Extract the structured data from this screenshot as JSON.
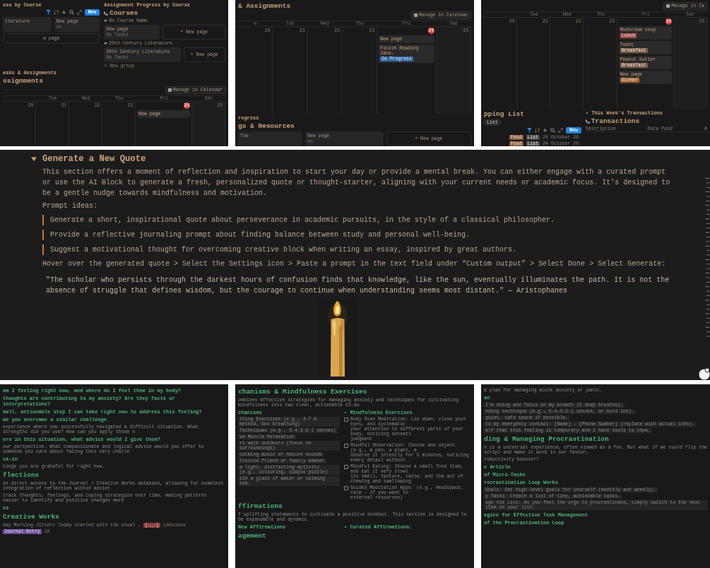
{
  "top_panels": [
    {
      "blocks": [
        {
          "kind": "columns",
          "columns": [
            [
              {
                "kind": "heading",
                "text": "ess by Course"
              },
              {
                "kind": "toolbar",
                "new_button": "New"
              },
              {
                "kind": "cards",
                "cards": [
                  {
                    "title": "iterature"
                  },
                  {
                    "title": "New page",
                    "sub": "on"
                  }
                ]
              },
              {
                "kind": "cards",
                "cards": [
                  {
                    "title": "w page",
                    "ghost": true
                  }
                ]
              }
            ],
            [
              {
                "kind": "heading",
                "text": "Assignment Progress by Course"
              },
              {
                "kind": "db_title",
                "text": "Courses"
              },
              {
                "kind": "group",
                "text": "No Course Name"
              },
              {
                "kind": "cards",
                "cards": [
                  {
                    "title": "New page",
                    "sub": "No Tasks"
                  },
                  {
                    "title": "+ New page",
                    "ghost": true
                  }
                ]
              },
              {
                "kind": "group",
                "text": "20th Century Literature"
              },
              {
                "kind": "cards",
                "cards": [
                  {
                    "title": "20th Century Literature",
                    "sub": "No Tasks"
                  },
                  {
                    "title": "+ New page",
                    "ghost": true
                  }
                ]
              },
              {
                "kind": "add_link",
                "text": "+ New group"
              }
            ]
          ]
        },
        {
          "kind": "subheading",
          "text": "asks & Assignments"
        },
        {
          "kind": "title",
          "text": "ssignments"
        },
        {
          "kind": "toolbar",
          "manage_button": "Manage in Calendar"
        },
        {
          "kind": "calendar",
          "columns": [
            {
              "date": "20"
            },
            {
              "day": "Tue",
              "date": "21"
            },
            {
              "day": "Wed",
              "date": "22"
            },
            {
              "day": "Thu",
              "date": "23"
            },
            {
              "day": "Fri",
              "date": "24",
              "today": true,
              "events": [
                {
                  "title": "New page"
                }
              ]
            },
            {
              "day": "Sat",
              "date": "25"
            }
          ]
        }
      ]
    },
    {
      "blocks": [
        {
          "kind": "title",
          "text": "& Assignments"
        },
        {
          "kind": "toolbar",
          "manage_button": "Manage in Calendar"
        },
        {
          "kind": "calendar",
          "columns": [
            {
              "day": "e",
              "date": "20"
            },
            {
              "day": "Tue",
              "date": "21"
            },
            {
              "day": "Wed",
              "date": "22"
            },
            {
              "day": "Thu",
              "date": "23"
            },
            {
              "day": "Fri",
              "date": "24",
              "today": true,
              "events": [
                {
                  "title": "New page"
                },
                {
                  "title": "Finish Reading Jane…",
                  "tag": "In Progress",
                  "color": "#2c6aa8"
                }
              ]
            },
            {
              "day": "Sat",
              "date": "25"
            }
          ]
        },
        {
          "kind": "subheading",
          "text": "rogress"
        },
        {
          "kind": "title",
          "text": "gs & Resources"
        },
        {
          "kind": "cards",
          "cards": [
            {
              "title": "Too"
            },
            {
              "title": "New page",
              "sub": "on"
            },
            {
              "title": "+ New page",
              "ghost": true
            }
          ]
        }
      ]
    },
    {
      "blocks": [
        {
          "kind": "toolbar",
          "manage_button": "Manage in Ca"
        },
        {
          "kind": "calendar",
          "columns": [
            {
              "date": "20"
            },
            {
              "day": "Tue",
              "date": "21"
            },
            {
              "day": "Wed",
              "date": "22"
            },
            {
              "day": "Thu",
              "date": "23"
            },
            {
              "day": "Fri",
              "date": "24",
              "today": true,
              "events": [
                {
                  "title": "Mushroom soup",
                  "tag": "Lunch",
                  "color": "#9c4a45"
                },
                {
                  "title": "Toast",
                  "tag": "Breakfast",
                  "color": "#7a5b47"
                },
                {
                  "title": "Peanut butter",
                  "tag": "Breakfast",
                  "color": "#7a5b47"
                },
                {
                  "title": "New page",
                  "tag": "Dinner",
                  "color": "#a5612c"
                }
              ]
            },
            {
              "day": "Sat",
              "date": "25"
            }
          ]
        },
        {
          "kind": "columns",
          "columns": [
            [
              {
                "kind": "title",
                "text": "pping List"
              },
              {
                "kind": "pill_tab",
                "text": "List"
              },
              {
                "kind": "toolbar",
                "new_button": "New"
              },
              {
                "kind": "db_row",
                "items": [
                  {
                    "kind": "tag",
                    "text": "Food",
                    "color": "#8a5f40"
                  },
                  {
                    "kind": "tag",
                    "text": "List",
                    "color": "#4a4a4a"
                  },
                  {
                    "kind": "text",
                    "text": "24 October 20…"
                  }
                ]
              },
              {
                "kind": "db_row",
                "items": [
                  {
                    "kind": "tag",
                    "text": "Food",
                    "color": "#8a5f40"
                  },
                  {
                    "kind": "tag",
                    "text": "List",
                    "color": "#4a4a4a"
                  },
                  {
                    "kind": "text",
                    "text": "24 October 20…"
                  }
                ]
              }
            ],
            [
              {
                "kind": "subheading",
                "text": "• This Week's Transactions"
              },
              {
                "kind": "db_title",
                "text": "Transactions"
              },
              {
                "kind": "table_header",
                "cells": [
                  "Description",
                  "Date Paid",
                  "A"
                ]
              }
            ]
          ]
        }
      ]
    }
  ],
  "quote_section": {
    "title": "Generate a New Quote",
    "expanded": true,
    "intro": "This section offers a moment of reflection and inspiration to start your day or provide a mental break. You can either engage with a curated prompt or use the AI Block to generate a fresh, personalized quote or thought-starter, aligning with your current needs or academic focus. It's designed to be a gentle nudge towards mindfulness and motivation.",
    "prompts_label": "Prompt ideas:",
    "prompts": [
      "Generate a short, inspirational quote about perseverance in academic pursuits, in the style of a classical philosopher.",
      "Provide a reflective journaling prompt about finding balance between study and personal well-being.",
      "Suggest a motivational thought for overcoming creative block when writing an essay, inspired by great authors."
    ],
    "instructions": "Hover over the generated quote > Select the Settings icon > Paste a prompt in the text field under “Custom output” > Select Done > Select Generate:",
    "quote": "\"The scholar who persists through the darkest hours of confusion finds that knowledge, like the sun, eventually illuminates the path. It is not the absence of struggle that defines wisdom, but the courage to continue when understanding seems most distant.\" — Aristophanes",
    "image": {
      "kind": "picture"
    }
  },
  "bottom_panels": [
    {
      "blocks": [
        {
          "kind": "subheading",
          "text": "am I feeling right now, and where do I feel them in my body?"
        },
        {
          "kind": "subheading",
          "text": "thoughts are contributing to my anxiety? Are they facts or interpretations?"
        },
        {
          "kind": "subheading",
          "text": "mall, actionable step I can take right now to address this feeling?"
        },
        {
          "kind": "subheading",
          "text": "me you overcame a similar challenge."
        },
        {
          "kind": "text",
          "text": "experience where you successfully navigated a difficult situation. What strengths did you use? How can you apply those n"
        },
        {
          "kind": "subheading",
          "text": "ere in this situation, what advice would I give them?"
        },
        {
          "kind": "text",
          "text": "our perspective. What compassionate and logical advice would you offer to someone you care about facing this very challe"
        },
        {
          "kind": "subheading",
          "text": "ck-in"
        },
        {
          "kind": "text",
          "text": "hings you are grateful for right now."
        },
        {
          "kind": "title",
          "text": "flections"
        },
        {
          "kind": "text",
          "text": "es direct access to the Journal / Creative Works database, allowing for seamless integration of reflection within anxiet"
        },
        {
          "kind": "text",
          "text": "track thoughts, feelings, and coping strategies over time, making patterns easier to identify and positive changes more"
        },
        {
          "kind": "subheading",
          "text": "es"
        },
        {
          "kind": "title",
          "text": "Creative Works"
        },
        {
          "kind": "db_row",
          "items": [
            {
              "kind": "text",
              "text": "day Morning Jitters"
            },
            {
              "kind": "text",
              "text": "Today started with the usual …"
            },
            {
              "kind": "tag",
              "text": "(-_-)",
              "color": "#8e3b3b"
            },
            {
              "kind": "page",
              "text": "Anxious"
            },
            {
              "kind": "tag",
              "text": "Journal Entry",
              "color": "#6b4a9c"
            },
            {
              "kind": "text",
              "text": "19"
            }
          ]
        }
      ]
    },
    {
      "blocks": [
        {
          "kind": "title",
          "text": "chanisms & Mindfulness Exercises"
        },
        {
          "kind": "text",
          "text": "ombines effective strategies for managing anxiety and techniques for cultivating mindfulness into two clear, actionable to-do"
        },
        {
          "kind": "columns",
          "columns": [
            [
              {
                "kind": "subheading",
                "text": "chanisms"
              },
              {
                "kind": "pills",
                "items": [
                  "thing Exercises (e.g., 4-7-8 method, box breathing)",
                  "Techniques (e.g., 5-4-3-2-1 senses)",
                  "ve Muscle Relaxation",
                  "rt walk outdoors (focus on surroundings)",
                  "calming music or nature sounds",
                  "trusted friend or family member",
                  "a light, distracting activity (e.g., colouring, simple puzzle)",
                  "ith a glass of water or calming tea."
                ]
              }
            ],
            [
              {
                "kind": "subheading",
                "text": "• Mindfulness Exercises"
              },
              {
                "kind": "checks",
                "items": [
                  {
                    "lines": [
                      "Body Scan Meditation: Lie down, close your eyes, and systematic",
                      "your attention to different parts of your body, noticing sensati",
                      "judgment"
                    ],
                    "checked": false
                  },
                  {
                    "lines": [
                      "Mindful Observation: Choose one object (e.g., a pen, a plant, a",
                      "observe it intently for 5 minutes, noticing every detail without"
                    ],
                    "checked": false
                  },
                  {
                    "lines": [
                      "Mindful Eating: Choose a small food item, and eat it very slowl",
                      "its smell, texture, taste, and the act of chewing and swallowing"
                    ],
                    "checked": false
                  },
                  {
                    "lines": [
                      "Guided Meditation Apps: (e.g., Headspace, Calm - if you want to",
                      "external resources)"
                    ],
                    "checked": false
                  }
                ]
              }
            ]
          ]
        },
        {
          "kind": "title",
          "text": "ffirmations"
        },
        {
          "kind": "text",
          "text": "f uplifting statements to cultivate a positive mindset. This section is designed to be expandable and dynamic."
        },
        {
          "kind": "columns",
          "columns": [
            [
              {
                "kind": "subheading",
                "text": "New Affirmations"
              }
            ],
            [
              {
                "kind": "subheading",
                "text": "• Curated Affirmations:"
              }
            ]
          ]
        },
        {
          "kind": "title",
          "text": "agement"
        }
      ]
    },
    {
      "blocks": [
        {
          "kind": "text",
          "text": "e plan for managing acute anxiety or panic."
        },
        {
          "kind": "subheading",
          "text": "an"
        },
        {
          "kind": "pills",
          "items": [
            "I'm doing and focus on my breath (5 deep breaths).",
            "nding technique (e.g., 5-4-3-2-1 senses, or hold ice).",
            "quiet, safe space if possible.",
            "to my emergency contact: [Name] - [Phone Number] (replace with actual info).",
            "elf that this feeling is temporary and I have tools to cope."
          ]
        },
        {
          "kind": "title",
          "text": "ding & Managing Procrastination"
        },
        {
          "kind": "text",
          "text": "n is a universal experience, often viewed as a foe. But what if we could flip the script and make it work in our favour,"
        },
        {
          "kind": "text",
          "text": "roductivity booster?"
        },
        {
          "kind": "subheading",
          "text": "e Article"
        },
        {
          "kind": "subheading",
          "text": "of Micro-Tasks"
        },
        {
          "kind": "subheading",
          "text": "rocrastination Loop Works"
        },
        {
          "kind": "pills",
          "items": [
            "Goals: Set high-level goals for yourself (monthly and weekly).",
            "y Tasks: Create a list of tiny, achievable tasks.",
            "ugh the List: As you feel the urge to procrastinate, simply switch to the next item on your list."
          ]
        },
        {
          "kind": "subheading",
          "text": "egies for Effective Task Management"
        },
        {
          "kind": "subheading",
          "text": "of the Procrastination Loop"
        }
      ]
    }
  ]
}
